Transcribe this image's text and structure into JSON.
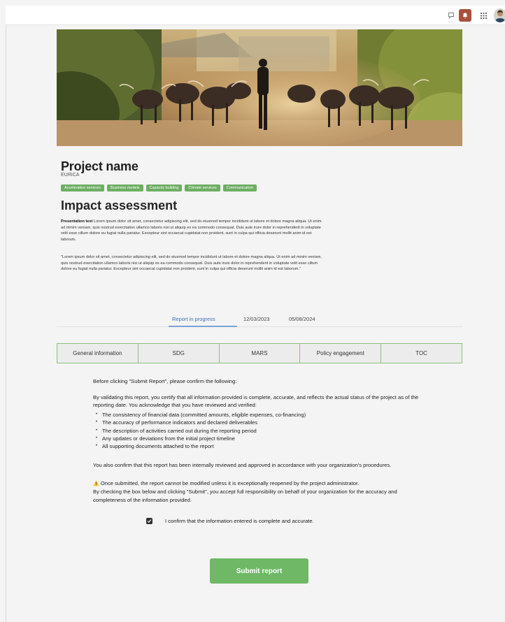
{
  "topbar": {
    "icons": [
      "chat-icon",
      "bell-icon",
      "grid-icon",
      "avatar"
    ]
  },
  "project": {
    "title": "Project name",
    "subtitle": "EURICA",
    "tags": [
      "Acceleration services",
      "Business models",
      "Capacity building",
      "Climate services",
      "Communication"
    ]
  },
  "assessment": {
    "title": "Impact assessment",
    "presentation_label": "Presentation text",
    "presentation_text": "Lorem ipsum dolor sit amet, consectetur adipiscing elit, sed do eiusmod tempor incididunt ut labore et dolore magna aliqua. Ut enim ad minim veniam, quis nostrud exercitation ullamco laboris nisi ut aliquip ex ea commodo consequat. Duis aute irure dolor in reprehenderit in voluptate velit esse cillum dolore eu fugiat nulla pariatur. Excepteur sint occaecat cupidatat non proident, sunt in culpa qui officia deserunt mollit anim id est laborum.",
    "quote_text": "\"Lorem ipsum dolor sit amet, consectetur adipiscing elit, sed do eiusmod tempor incididunt ut labore et dolore magna aliqua. Ut enim ad minim veniam, quis nostrud exercitation ullamco laboris nisi ut aliquip ex ea commodo consequat. Duis aute irure dolor in reprehenderit in voluptate velit esse cillum dolore eu fugiat nulla pariatur. Excepteur sint occaecat cupidatat non proident, sunt in culpa qui officia deserunt mollit anim id est laborum.\""
  },
  "status": {
    "label": "Report in progress",
    "date_start": "12/03/2023",
    "date_end": "05/08/2024"
  },
  "tabs": [
    "General information",
    "SDG",
    "MARS",
    "Policy engagement",
    "TOC"
  ],
  "submission": {
    "intro": "Before clicking \"Submit Report\", please confirm the following:",
    "validation": "By validating this report, you certify that all information provided is complete, accurate, and reflects the actual status of the project as of the reporting date. You acknowledge that you have reviewed and verified:",
    "checklist": [
      "The consistency of financial data (committed amounts, eligible expenses, co-financing)",
      "The accuracy of performance indicators and declared deliverables",
      "The description of activities carried out during the reporting period",
      "Any updates or deviations from the initial project timeline",
      "All supporting documents attached to the report"
    ],
    "approval": "You also confirm that this report has been internally reviewed and approved in accordance with your organization's procedures.",
    "warning_icon": "⚠️",
    "warning": "Once submitted, the report cannot be modified unless it is exceptionally reopened by the project administrator.",
    "responsibility": "By checking the box below and clicking \"Submit\", you accept full responsibility on behalf of your organization for the accuracy and completeness of the information provided.",
    "confirm_label": "I confirm that the information entered is complete and accurate.",
    "confirm_checked": true,
    "submit_label": "Submit report"
  },
  "colors": {
    "accent_green": "#6eb866",
    "tag_green": "#6dae63",
    "bell_bg": "#a8513a",
    "status_blue": "#3b6fb6"
  }
}
